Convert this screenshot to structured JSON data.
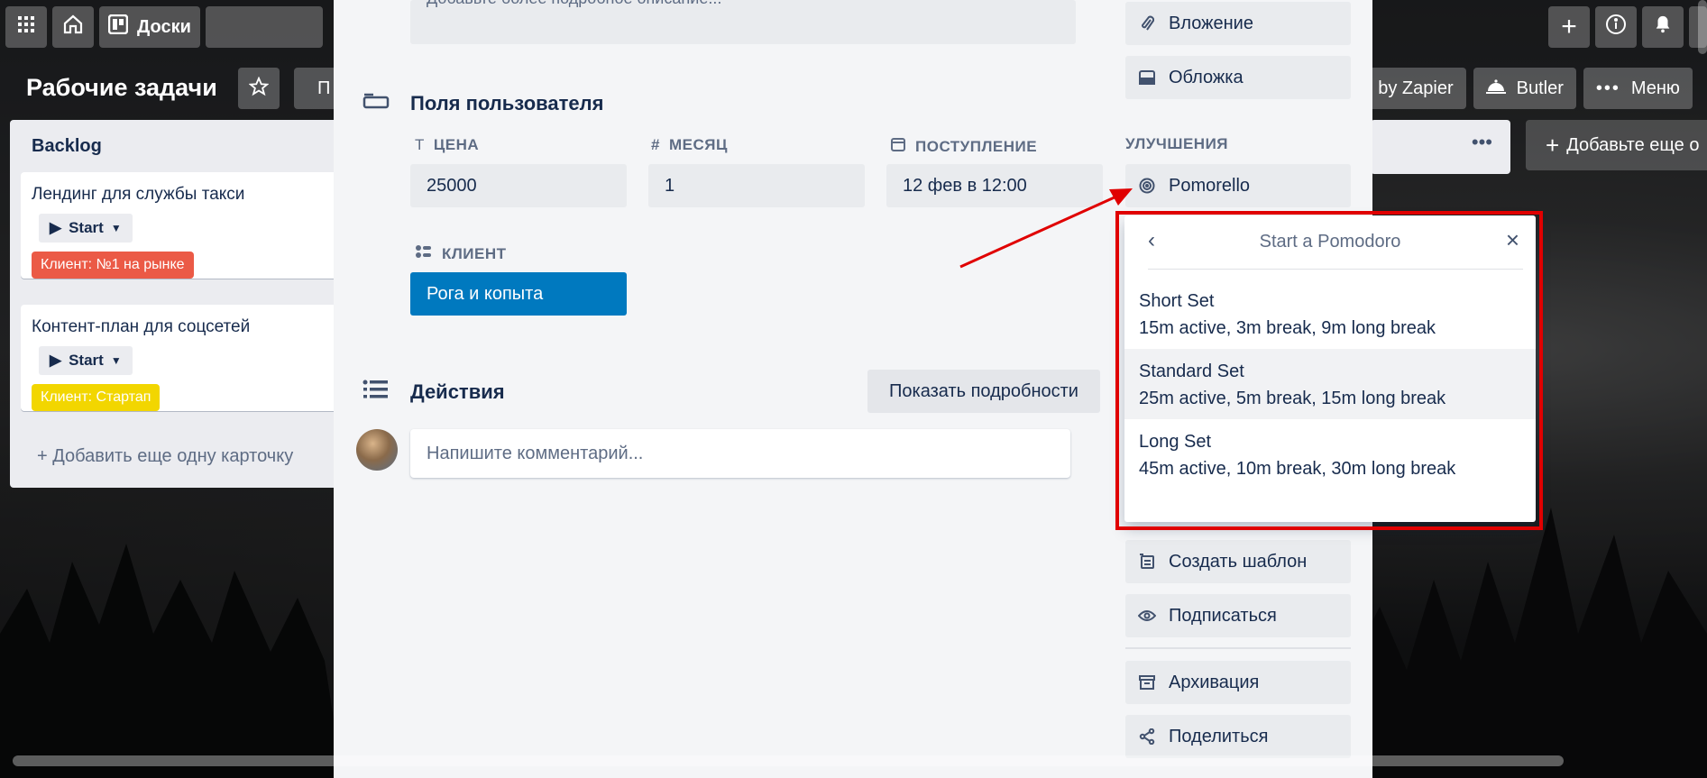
{
  "header": {
    "boards_label": "Доски"
  },
  "board": {
    "title": "Рабочие задачи",
    "tab_fragment": "П",
    "zapier_label": "te by Zapier",
    "butler_label": "Butler",
    "menu_label": "Меню"
  },
  "list": {
    "title": "Backlog",
    "cards": [
      {
        "title": "Лендинг для службы такси",
        "start_label": "Start",
        "label_text": "Клиент: №1 на рынке",
        "label_color": "#eb5a46"
      },
      {
        "title": "Контент-план для соцсетей",
        "start_label": "Start",
        "label_text": "Клиент: Стартап",
        "label_color": "#f2d600"
      }
    ],
    "add_card": "Добавить еще одну карточку"
  },
  "add_list": "Добавьте еще о",
  "modal": {
    "desc_placeholder": "Добавьте более подробное описание...",
    "custom_fields_title": "Поля пользователя",
    "fields": [
      {
        "label": "ЦЕНА",
        "value": "25000"
      },
      {
        "label": "МЕСЯЦ",
        "value": "1"
      },
      {
        "label": "ПОСТУПЛЕНИЕ",
        "value": "12 фев в 12:00"
      },
      {
        "label": "КЛИЕНТ",
        "value": "Рога и копыта"
      }
    ],
    "activity_title": "Действия",
    "show_details": "Показать подробности",
    "comment_placeholder": "Напишите комментарий..."
  },
  "sidebar": {
    "attachment": "Вложение",
    "cover": "Обложка",
    "powerups_heading": "УЛУЧШЕНИЯ",
    "pomorello": "Pomorello",
    "create_template": "Создать шаблон",
    "subscribe": "Подписаться",
    "archive": "Архивация",
    "share": "Поделиться"
  },
  "popover": {
    "title": "Start a Pomodoro",
    "items": [
      {
        "name": "Short Set",
        "desc": "15m active, 3m break, 9m long break"
      },
      {
        "name": "Standard Set",
        "desc": "25m active, 5m break, 15m long break"
      },
      {
        "name": "Long Set",
        "desc": "45m active, 10m break, 30m long break"
      }
    ]
  },
  "colors": {
    "accent_blue": "#0079bf",
    "annotation_red": "#e00000"
  }
}
